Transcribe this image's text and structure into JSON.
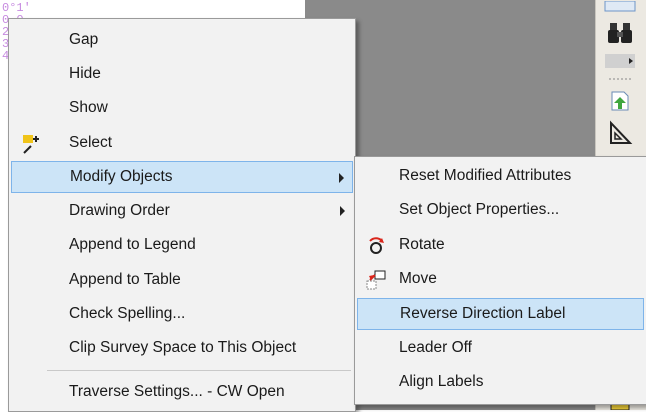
{
  "background": {
    "coord_lines": [
      "0°1'",
      "0.0",
      "2",
      "3",
      "4"
    ]
  },
  "context_menu": {
    "items": [
      {
        "label": "Gap",
        "submenu": false,
        "highlighted": false,
        "icon": ""
      },
      {
        "label": "Hide",
        "submenu": false,
        "highlighted": false,
        "icon": ""
      },
      {
        "label": "Show",
        "submenu": false,
        "highlighted": false,
        "icon": ""
      },
      {
        "label": "Select",
        "submenu": false,
        "highlighted": false,
        "icon": "select-icon"
      },
      {
        "label": "Modify Objects",
        "submenu": true,
        "highlighted": true,
        "icon": ""
      },
      {
        "label": "Drawing Order",
        "submenu": true,
        "highlighted": false,
        "icon": ""
      },
      {
        "label": "Append to Legend",
        "submenu": false,
        "highlighted": false,
        "icon": ""
      },
      {
        "label": "Append to Table",
        "submenu": false,
        "highlighted": false,
        "icon": ""
      },
      {
        "label": "Check Spelling...",
        "submenu": false,
        "highlighted": false,
        "icon": ""
      },
      {
        "label": "Clip Survey Space to This Object",
        "submenu": false,
        "highlighted": false,
        "icon": ""
      },
      {
        "label": "Traverse Settings... - CW Open",
        "submenu": false,
        "highlighted": false,
        "icon": ""
      }
    ]
  },
  "submenu": {
    "items": [
      {
        "label": "Reset Modified Attributes",
        "highlighted": false,
        "icon": ""
      },
      {
        "label": "Set Object Properties...",
        "highlighted": false,
        "icon": ""
      },
      {
        "label": "Rotate",
        "highlighted": false,
        "icon": "rotate-icon"
      },
      {
        "label": "Move",
        "highlighted": false,
        "icon": "move-icon"
      },
      {
        "label": "Reverse Direction Label",
        "highlighted": true,
        "icon": ""
      },
      {
        "label": "Leader Off",
        "highlighted": false,
        "icon": ""
      },
      {
        "label": "Align Labels",
        "highlighted": false,
        "icon": ""
      }
    ]
  },
  "colors": {
    "highlight_fill": "#cce4f7",
    "highlight_border": "#7eb4ea",
    "menu_bg": "#f2f2f2",
    "canvas_dark": "#8a8a8a"
  }
}
